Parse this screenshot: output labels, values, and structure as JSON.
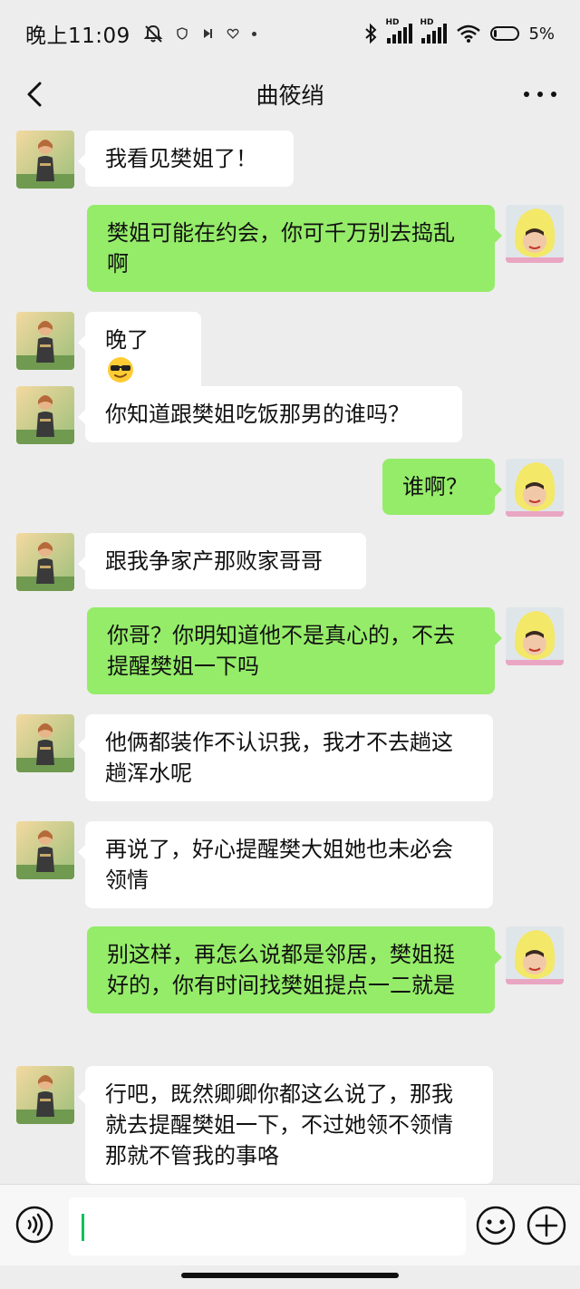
{
  "status_bar": {
    "time": "晚上11:09",
    "battery_text": "5%",
    "signal_label": "HD"
  },
  "chat": {
    "title": "曲筱绡"
  },
  "messages": [
    {
      "side": "in",
      "text": "我看见樊姐了！"
    },
    {
      "side": "out",
      "text": "樊姐可能在约会，你可千万别去捣乱啊"
    },
    {
      "side": "in",
      "text": "晚了",
      "emoji": "sunglasses-emoji"
    },
    {
      "side": "in",
      "text": "你知道跟樊姐吃饭那男的谁吗？"
    },
    {
      "side": "out",
      "text": "谁啊？"
    },
    {
      "side": "in",
      "text": "跟我争家产那败家哥哥"
    },
    {
      "side": "out",
      "text": "你哥？你明知道他不是真心的，不去提醒樊姐一下吗"
    },
    {
      "side": "in",
      "text": "他俩都装作不认识我，我才不去趟这趟浑水呢"
    },
    {
      "side": "in",
      "text": "再说了，好心提醒樊大姐她也未必会领情"
    },
    {
      "side": "out",
      "text": "别这样，再怎么说都是邻居，樊姐挺好的，你有时间找樊姐提点一二就是"
    },
    {
      "side": "in",
      "text": "行吧，既然卿卿你都这么说了，那我就去提醒樊姐一下，不过她领不领情那就不管我的事咯"
    }
  ],
  "colors": {
    "background": "#ededed",
    "incoming_bubble": "#ffffff",
    "outgoing_bubble": "#95ec69",
    "caret": "#07c160"
  },
  "icons": {
    "back": "chevron-left-icon",
    "more": "more-dots-icon",
    "voice": "voice-icon",
    "emoji": "emoji-icon",
    "plus": "plus-icon"
  }
}
